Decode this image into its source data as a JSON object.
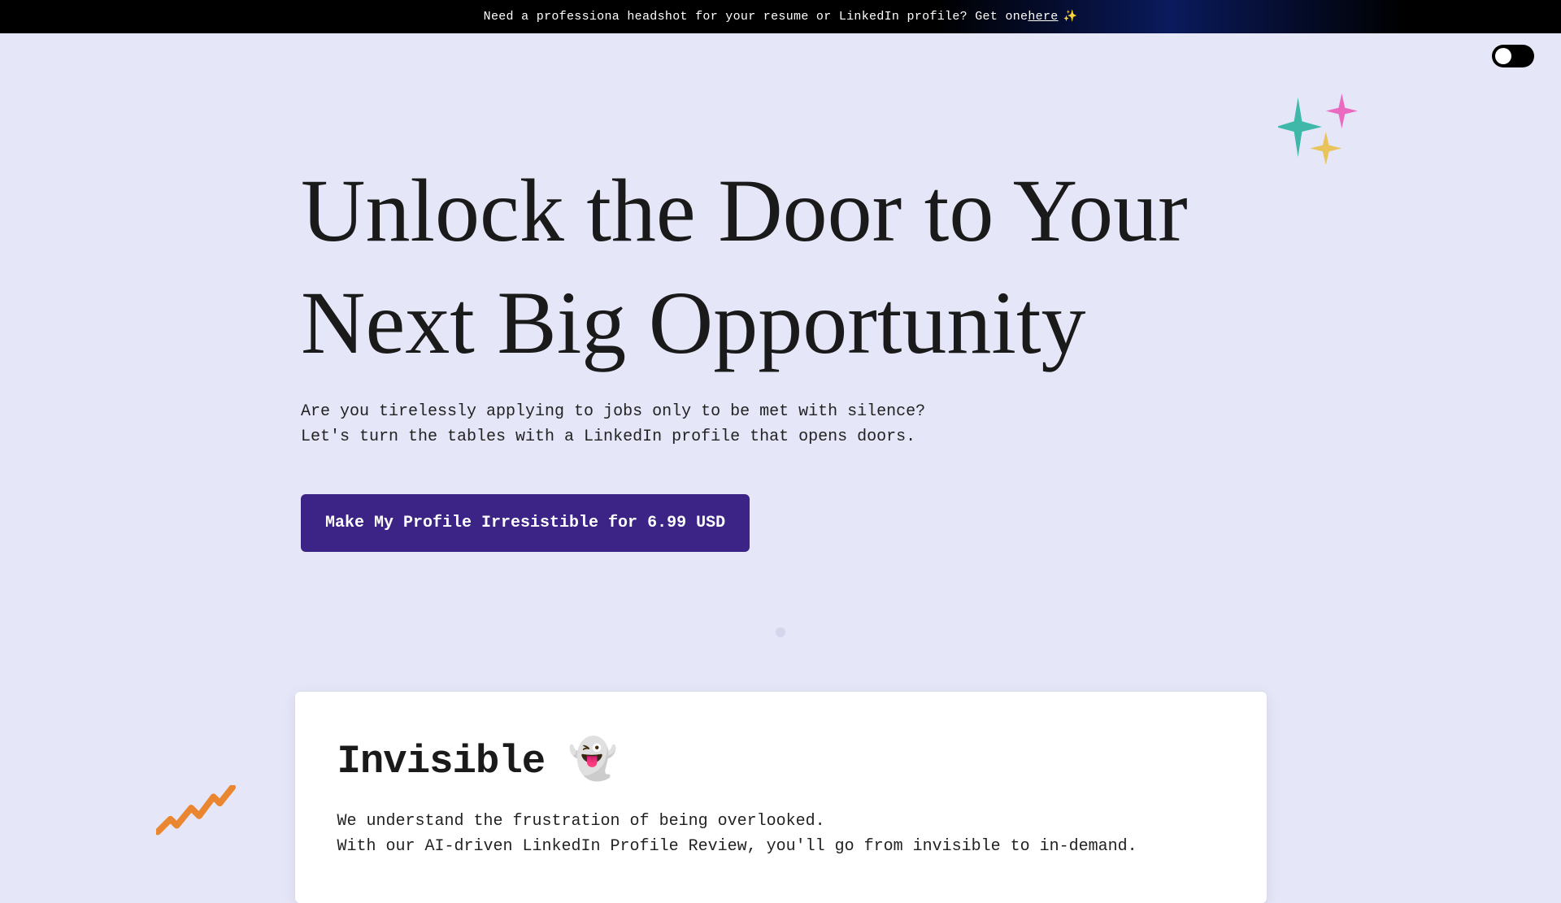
{
  "banner": {
    "text_before_link": "Need a professiona headshot for your resume or LinkedIn profile? Get one ",
    "link_text": "here",
    "sparkle": "✨"
  },
  "hero": {
    "title": "Unlock the Door to Your Next Big Opportunity",
    "sub_line1": "Are you tirelessly applying to jobs only to be met with silence?",
    "sub_line2": "Let's turn the tables with a LinkedIn profile that opens doors.",
    "cta_label": "Make My Profile Irresistible for 6.99 USD"
  },
  "card": {
    "title": "Invisible 👻",
    "body_line1": "We understand the frustration of being overlooked.",
    "body_line2": "With our AI-driven LinkedIn Profile Review, you'll go from invisible to in-demand."
  },
  "colors": {
    "bg": "#E5E6F8",
    "cta_bg": "#3C2487",
    "spark_teal": "#3FB8A9",
    "spark_pink": "#E96ABF",
    "spark_gold": "#E9C45B",
    "zigzag": "#E9862F"
  }
}
